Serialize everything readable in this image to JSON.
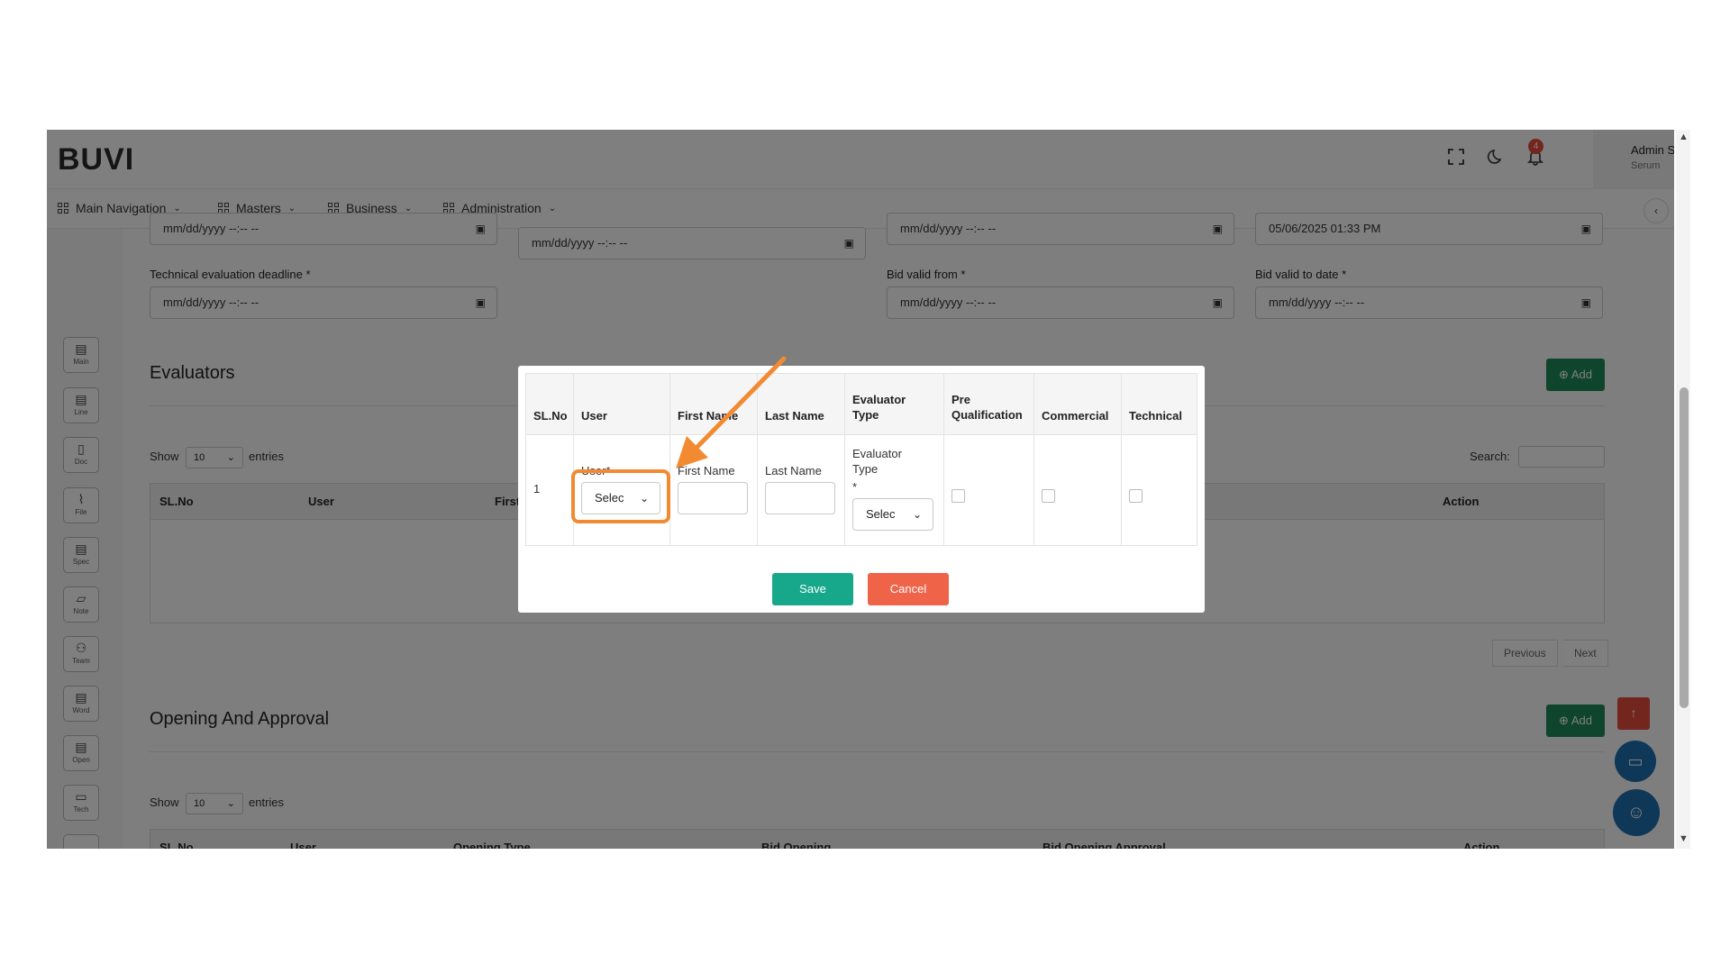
{
  "app": {
    "logo": "BUVI",
    "notification_count": "4",
    "user_name": "Admin Serum",
    "user_role": "Serum"
  },
  "nav": {
    "items": [
      {
        "label": "Main Navigation"
      },
      {
        "label": "Masters"
      },
      {
        "label": "Business"
      },
      {
        "label": "Administration"
      }
    ]
  },
  "side": {
    "items": [
      {
        "label": "Main",
        "icon": "▤"
      },
      {
        "label": "Line",
        "icon": "▤"
      },
      {
        "label": "Doc",
        "icon": "▯"
      },
      {
        "label": "File",
        "icon": "⌇"
      },
      {
        "label": "Spec",
        "icon": "▤"
      },
      {
        "label": "Note",
        "icon": "▱"
      },
      {
        "label": "Team",
        "icon": "⚇"
      },
      {
        "label": "Word",
        "icon": "▤"
      },
      {
        "label": "Open",
        "icon": "▤"
      },
      {
        "label": "Tech",
        "icon": "▭"
      }
    ]
  },
  "dates": {
    "placeholder": "mm/dd/yyyy --:-- --",
    "top_row_partial_4": "05/06/2025 01:33 PM",
    "tech_eval_label": "Technical evaluation deadline *",
    "bid_from_label": "Bid valid from *",
    "bid_to_label": "Bid valid to date *"
  },
  "evaluators": {
    "title": "Evaluators",
    "add_label": "Add",
    "show": "Show",
    "entries": "entries",
    "page_size": "10",
    "search_label": "Search:",
    "columns": [
      "SL.No",
      "User",
      "First",
      "Action"
    ],
    "previous": "Previous",
    "next": "Next"
  },
  "opening": {
    "title": "Opening And Approval",
    "add_label": "Add",
    "show": "Show",
    "entries": "entries",
    "page_size": "10",
    "columns": [
      "SL.No",
      "User",
      "Opening Type",
      "Bid Opening",
      "Bid Opening Approval",
      "Action"
    ]
  },
  "modal": {
    "headers": {
      "slno": "SL.No",
      "user": "User",
      "first_name": "First Name",
      "last_name": "Last Name",
      "evaluator_type": "Evaluator Type",
      "pre_qualification": "Pre Qualification",
      "commercial": "Commercial",
      "technical": "Technical"
    },
    "row": {
      "slno": "1",
      "user_label": "User*",
      "user_select": "Selec",
      "first_name_label": "First Name",
      "last_name_label": "Last Name",
      "evaluator_type_label": "Evaluator Type",
      "evaluator_required": "*",
      "evaluator_select": "Selec"
    },
    "save": "Save",
    "cancel": "Cancel"
  },
  "colors": {
    "save": "#17a88c",
    "cancel": "#ef6348",
    "highlight": "#f28a32",
    "add": "#1e8a5a"
  }
}
